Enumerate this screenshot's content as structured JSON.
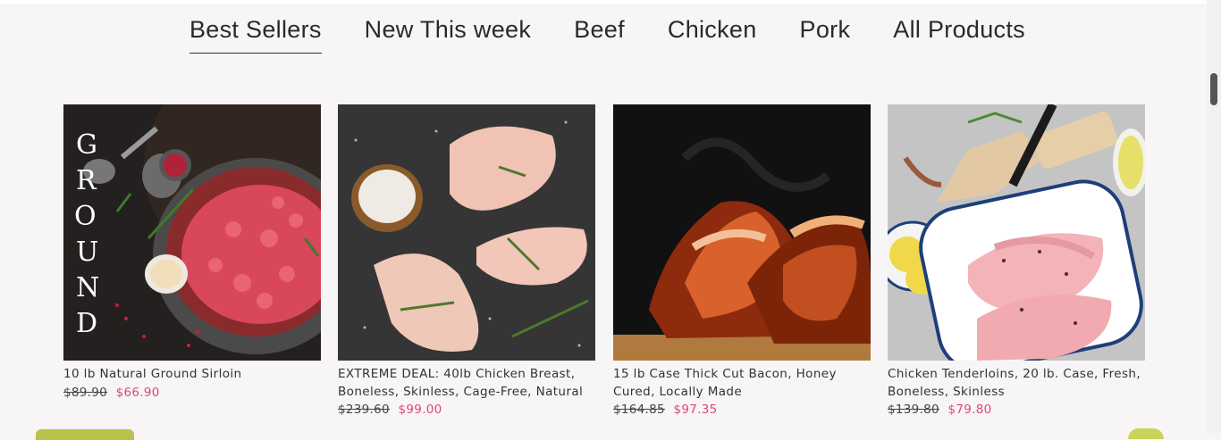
{
  "tabs": [
    {
      "label": "Best Sellers",
      "active": true
    },
    {
      "label": "New This week",
      "active": false
    },
    {
      "label": "Beef",
      "active": false
    },
    {
      "label": "Chicken",
      "active": false
    },
    {
      "label": "Pork",
      "active": false
    },
    {
      "label": "All Products",
      "active": false
    }
  ],
  "products": [
    {
      "title": "10 lb Natural Ground Sirloin",
      "old_price": "$89.90",
      "new_price": "$66.90",
      "image_overlay_text": "GROUND"
    },
    {
      "title": "EXTREME DEAL: 40lb Chicken Breast, Boneless, Skinless, Cage-Free, Natural",
      "old_price": "$239.60",
      "new_price": "$99.00"
    },
    {
      "title": "15 lb Case Thick Cut Bacon, Honey Cured, Locally Made",
      "old_price": "$164.85",
      "new_price": "$97.35"
    },
    {
      "title": "Chicken Tenderloins, 20 lb. Case, Fresh, Boneless, Skinless",
      "old_price": "$139.80",
      "new_price": "$79.80"
    }
  ],
  "colors": {
    "sale_price": "#e0457b",
    "accent_green": "#b9c24a"
  }
}
